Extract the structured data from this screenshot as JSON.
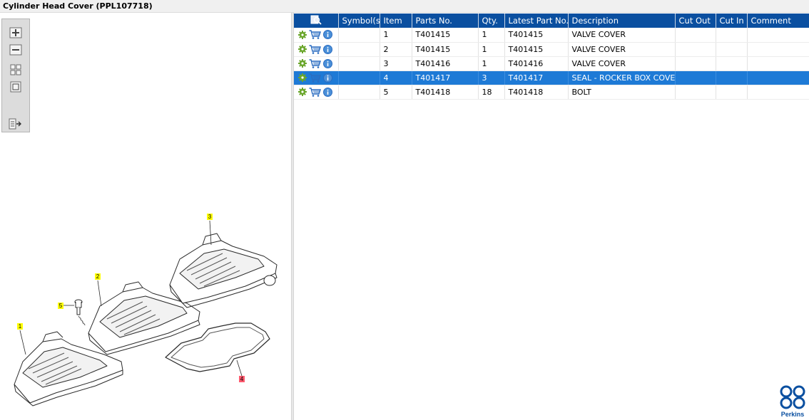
{
  "window": {
    "title": "Cylinder Head Cover (PPL107718)"
  },
  "toolbox": {
    "tools": [
      {
        "name": "zoom-in-icon"
      },
      {
        "name": "zoom-out-icon"
      },
      {
        "name": "fit-all-icon"
      },
      {
        "name": "fit-window-icon"
      },
      {
        "name": "export-list-icon"
      }
    ]
  },
  "diagram": {
    "callouts": [
      {
        "label": "1",
        "color": "#ffff00"
      },
      {
        "label": "2",
        "color": "#ffff00"
      },
      {
        "label": "3",
        "color": "#ffff00"
      },
      {
        "label": "4",
        "color": "#ff5a6e"
      },
      {
        "label": "5",
        "color": "#ffff00"
      }
    ]
  },
  "parts_table": {
    "columns": [
      "Symbol(s)",
      "Item",
      "Parts No.",
      "Qty.",
      "Latest Part No.",
      "Description",
      "Cut Out",
      "Cut In",
      "Comment"
    ],
    "selected_index": 3,
    "rows": [
      {
        "item": "1",
        "part_no": "T401415",
        "qty": "1",
        "latest_part_no": "T401415",
        "description": "VALVE COVER",
        "cut_out": "",
        "cut_in": "",
        "comment": ""
      },
      {
        "item": "2",
        "part_no": "T401415",
        "qty": "1",
        "latest_part_no": "T401415",
        "description": "VALVE COVER",
        "cut_out": "",
        "cut_in": "",
        "comment": ""
      },
      {
        "item": "3",
        "part_no": "T401416",
        "qty": "1",
        "latest_part_no": "T401416",
        "description": "VALVE COVER",
        "cut_out": "",
        "cut_in": "",
        "comment": ""
      },
      {
        "item": "4",
        "part_no": "T401417",
        "qty": "3",
        "latest_part_no": "T401417",
        "description": "SEAL - ROCKER BOX COVER",
        "cut_out": "",
        "cut_in": "",
        "comment": ""
      },
      {
        "item": "5",
        "part_no": "T401418",
        "qty": "18",
        "latest_part_no": "T401418",
        "description": "BOLT",
        "cut_out": "",
        "cut_in": "",
        "comment": ""
      }
    ]
  },
  "brand": {
    "name": "Perkins",
    "color": "#0a4fa0"
  },
  "colors": {
    "header_bg": "#0a4fa0",
    "selected_row": "#1e7ad6",
    "gear_green": "#6aa62b",
    "cart_blue": "#2a6cc0"
  }
}
